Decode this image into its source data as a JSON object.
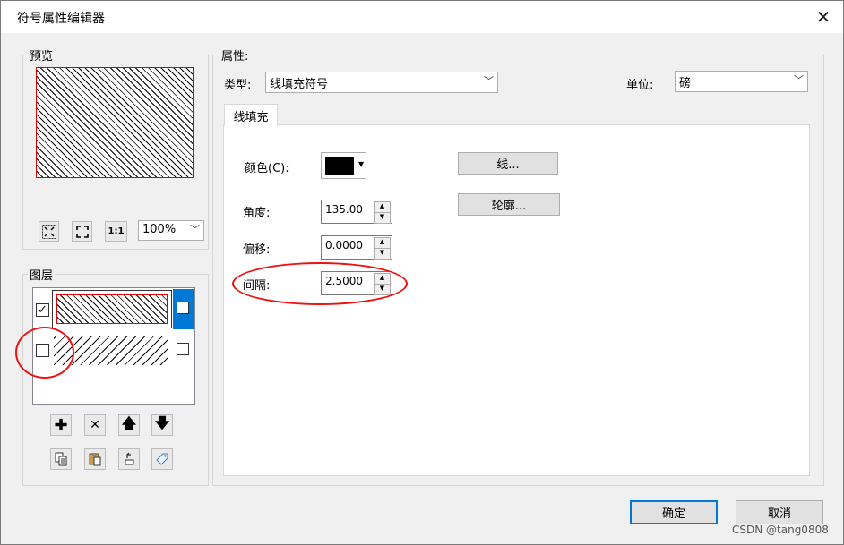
{
  "window": {
    "title": "符号属性编辑器"
  },
  "preview": {
    "label": "预览",
    "zoom": "100%"
  },
  "layers": {
    "label": "图层",
    "items": [
      {
        "checked": true
      },
      {
        "checked": false
      }
    ]
  },
  "properties": {
    "label": "属性:",
    "type_label": "类型:",
    "type_value": "线填充符号",
    "unit_label": "单位:",
    "unit_value": "磅",
    "tab": "线填充",
    "color_label": "颜色(C):",
    "color_value": "#000000",
    "angle_label": "角度:",
    "angle_value": "135.00",
    "offset_label": "偏移:",
    "offset_value": "0.0000",
    "spacing_label": "间隔:",
    "spacing_value": "2.5000",
    "line_button": "线...",
    "outline_button": "轮廓..."
  },
  "footer": {
    "ok": "确定",
    "cancel": "取消"
  },
  "watermark": "CSDN @tang0808"
}
